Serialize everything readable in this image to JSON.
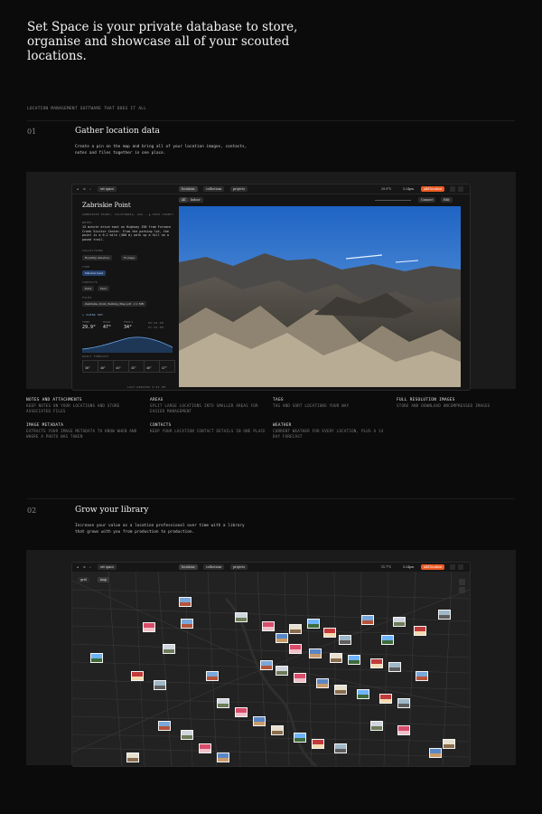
{
  "headline": "Set Space is your private database to store, organise and showcase all of your scouted locations.",
  "kicker": "LOCATION MANAGEMENT SOFTWARE THAT DOES IT ALL",
  "section1": {
    "number": "01",
    "title": "Gather location data",
    "description": "Create a pin on the map and bring all of your location images, contacts, notes and files together in one place."
  },
  "section2": {
    "number": "02",
    "title": "Grow your library",
    "description": "Increase your value as a location professional over time with a library that grows with you from production to production."
  },
  "app": {
    "workspace": "set space",
    "tabs": [
      "locations",
      "collections",
      "projects"
    ],
    "weather_temp": "29.9°C",
    "time": "5:24pm",
    "cta": "Add location",
    "map_temp": "11.7°C",
    "map_time": "5:24pm",
    "map_toggle_a": "grid",
    "map_toggle_b": "map"
  },
  "detail": {
    "title": "Zabriskie Point",
    "address": "ZABRISKIE POINT, CALIFORNIA, USA · ▲ INYO COUNTY",
    "notes_label": "NOTES",
    "notes": "14 minute drive east on Highway 190 from Furnace Creek Visitor Center. From the parking lot, the point is a 0.2 mile (400 m) walk up a hill on a paved trail.",
    "collections_label": "COLLECTIONS",
    "collections": [
      "Roadtrip America",
      "Footage"
    ],
    "type_label": "TYPE",
    "type_value": "Natural Land",
    "contacts_label": "CONTACTS",
    "contacts": [
      "Kara",
      "Paul"
    ],
    "files_label": "FILES",
    "file": "Zabriskie_Point_Parking_Map.pdf",
    "file_size": "2.1 MB",
    "weather_label": "CLEAR SKY",
    "weather_stats": [
      {
        "label": "TEMP",
        "value": "29.9°"
      },
      {
        "label": "HIGH",
        "value": "47°"
      },
      {
        "label": "FEELS",
        "value": "34°"
      }
    ],
    "sun_times": [
      "06:44 AM",
      "07:34 PM"
    ],
    "forecast_label": "DAILY FORECAST",
    "forecast": [
      "30°",
      "40°",
      "44°",
      "45°",
      "46°",
      "47°"
    ],
    "footer": "LAST UPDATED 5:21 PM"
  },
  "viewer": {
    "tab_a": "All",
    "tab_b": "Indoor",
    "action_a": "Connect",
    "action_b": "Edit"
  },
  "features": [
    {
      "title": "NOTES AND ATTACHMENTS",
      "desc": "KEEP NOTES ON YOUR LOCATIONS AND STORE ASSOCIATED FILES"
    },
    {
      "title": "AREAS",
      "desc": "SPLIT LARGE LOCATIONS INTO SMALLER AREAS FOR EASIER MANAGEMENT"
    },
    {
      "title": "TAGS",
      "desc": "TAG AND SORT LOCATIONS YOUR WAY"
    },
    {
      "title": "FULL RESOLUTION IMAGES",
      "desc": "STORE AND DOWNLOAD UNCOMPRESSED IMAGES"
    },
    {
      "title": "IMAGE METADATA",
      "desc": "EXTRACTS YOUR IMAGE METADATA TO KNOW WHEN AND WHERE A PHOTO WAS TAKEN"
    },
    {
      "title": "CONTACTS",
      "desc": "KEEP YOUR LOCATION CONTACT DETAILS IN ONE PLACE"
    },
    {
      "title": "WEATHER",
      "desc": "CURRENT WEATHER FOR EVERY LOCATION, PLUS A 14 DAY FORECAST"
    }
  ],
  "colors": {
    "accent": "#ec5a24",
    "background": "#0b0b0b",
    "panel": "#1b1b1b"
  }
}
